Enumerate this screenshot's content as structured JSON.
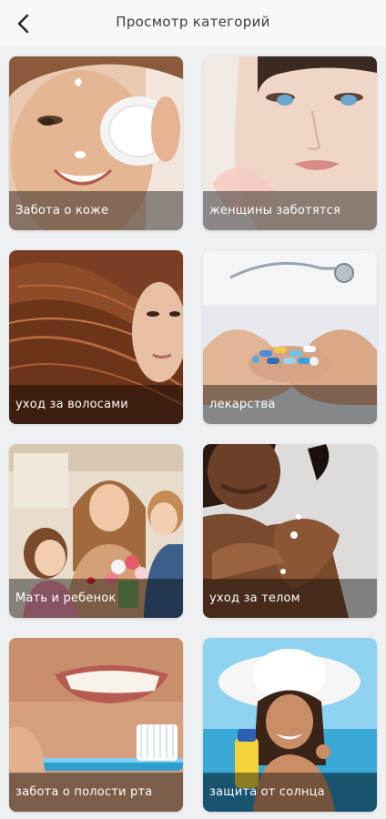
{
  "header": {
    "title": "Просмотр категорий",
    "back_icon": "back-arrow-icon"
  },
  "categories": [
    {
      "label": "Забота о коже",
      "image": "skin-care-photo"
    },
    {
      "label": "женщины заботятся",
      "image": "women-care-photo"
    },
    {
      "label": "уход за волосами",
      "image": "hair-care-photo"
    },
    {
      "label": "лекарства",
      "image": "medicine-photo"
    },
    {
      "label": "Мать и ребенок",
      "image": "mother-child-photo"
    },
    {
      "label": "уход за телом",
      "image": "body-care-photo"
    },
    {
      "label": "забота о полости рта",
      "image": "oral-care-photo"
    },
    {
      "label": "защита от солнца",
      "image": "sun-protection-photo"
    }
  ],
  "colors": {
    "background": "#eef0f4",
    "label_overlay": "rgba(0,0,0,0.42)"
  }
}
